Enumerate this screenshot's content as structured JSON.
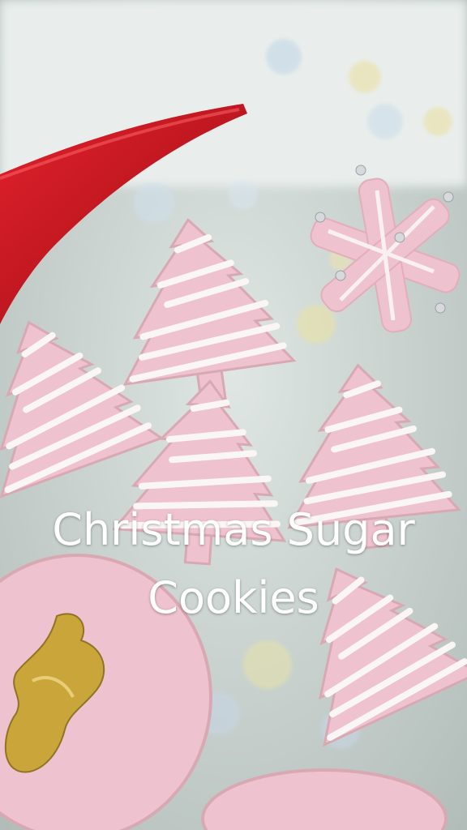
{
  "caption": {
    "line1": "Christmas Sugar",
    "line2": "Cookies"
  },
  "colors": {
    "cookie_pink": "#efc2cf",
    "icing_white": "#fbf6f6",
    "ribbon_red": "#c9141f",
    "gold_ornament": "#c9a53a",
    "plate_background": "#cdd7d4"
  }
}
